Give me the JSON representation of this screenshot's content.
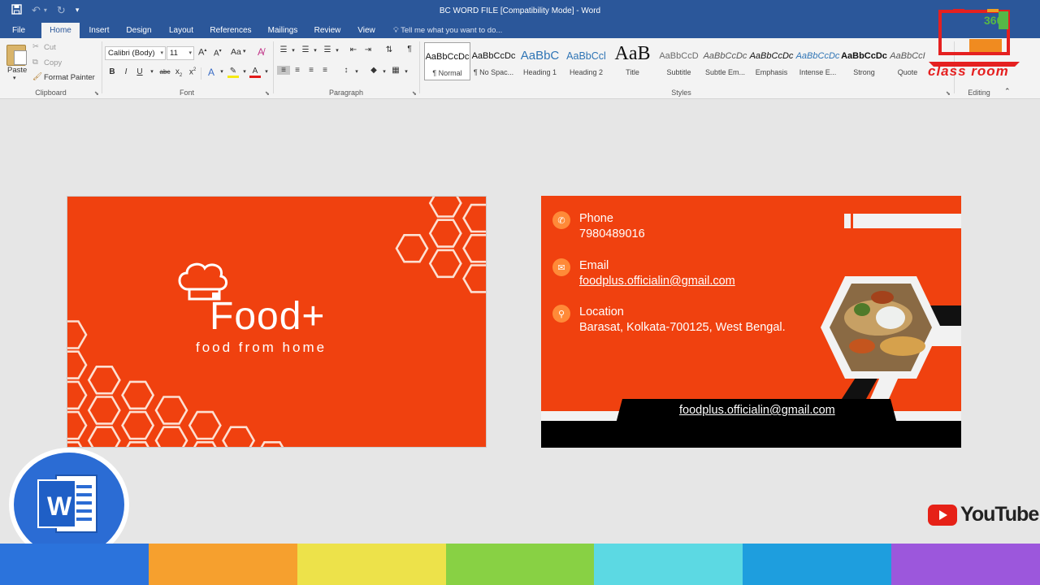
{
  "window": {
    "title": "BC WORD FILE [Compatibility Mode] - Word"
  },
  "qat": {
    "save_icon": "save-icon",
    "undo_icon": "undo-icon",
    "redo_icon": "redo-icon",
    "customize_icon": "customize-qat-icon"
  },
  "tabs": [
    {
      "label": "File"
    },
    {
      "label": "Home"
    },
    {
      "label": "Insert"
    },
    {
      "label": "Design"
    },
    {
      "label": "Layout"
    },
    {
      "label": "References"
    },
    {
      "label": "Mailings"
    },
    {
      "label": "Review"
    },
    {
      "label": "View"
    }
  ],
  "tell_me": {
    "placeholder": "Tell me what you want to do..."
  },
  "clipboard": {
    "paste": "Paste",
    "cut": "Cut",
    "copy": "Copy",
    "format_painter": "Format Painter",
    "group": "Clipboard"
  },
  "font": {
    "name": "Calibri (Body)",
    "size": "11",
    "change_case": "Aa",
    "group": "Font"
  },
  "paragraph": {
    "group": "Paragraph"
  },
  "styles": {
    "group": "Styles",
    "items": [
      {
        "preview": "AaBbCcDc",
        "name": "¶ Normal"
      },
      {
        "preview": "AaBbCcDc",
        "name": "¶ No Spac..."
      },
      {
        "preview": "AaBbC",
        "name": "Heading 1"
      },
      {
        "preview": "AaBbCcl",
        "name": "Heading 2"
      },
      {
        "preview": "AaB",
        "name": "Title"
      },
      {
        "preview": "AaBbCcD",
        "name": "Subtitle"
      },
      {
        "preview": "AaBbCcDc",
        "name": "Subtle Em..."
      },
      {
        "preview": "AaBbCcDc",
        "name": "Emphasis"
      },
      {
        "preview": "AaBbCcDc",
        "name": "Intense E..."
      },
      {
        "preview": "AaBbCcDc",
        "name": "Strong"
      },
      {
        "preview": "AaBbCcI",
        "name": "Quote"
      }
    ]
  },
  "editing": {
    "group": "Editing"
  },
  "watermark": {
    "text": "class room"
  },
  "card_front": {
    "brand": "Food+",
    "tagline": "food from home",
    "bg": "#f0410f"
  },
  "card_back": {
    "phone_label": "Phone",
    "phone": "7980489016",
    "email_label": "Email",
    "email": "foodplus.officialin@gmail.com",
    "location_label": "Location",
    "location": "Barasat, Kolkata-700125, West Bengal.",
    "footer_email": "foodplus.officialin@gmail.com"
  },
  "overlay": {
    "word_letter": "W",
    "youtube": "YouTube"
  },
  "bottom_colors": [
    "#2b73dc",
    "#f6a02e",
    "#ede24a",
    "#88d144",
    "#5cd9e3",
    "#1e9ede",
    "#9c57dc"
  ]
}
